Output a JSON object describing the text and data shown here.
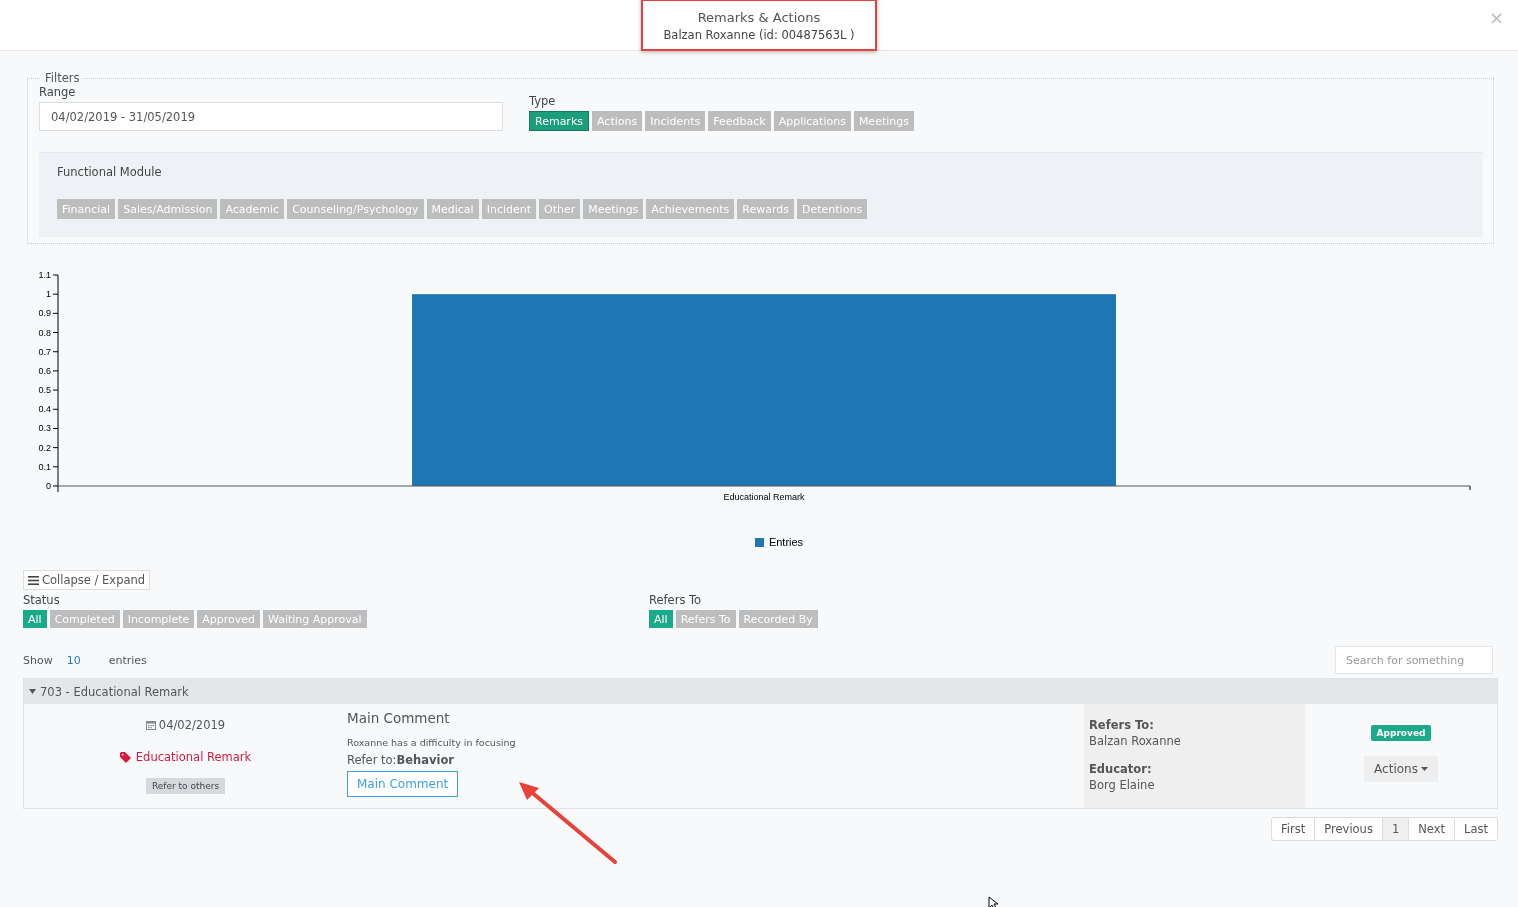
{
  "header": {
    "title": "Remarks & Actions",
    "subtitle": "Balzan Roxanne (id: 00487563L )",
    "close": "×"
  },
  "filters": {
    "legend": "Filters",
    "range_label": "Range",
    "range_value": "04/02/2019 - 31/05/2019",
    "type_label": "Type",
    "types": [
      {
        "label": "Remarks",
        "selected": true
      },
      {
        "label": "Actions",
        "selected": false
      },
      {
        "label": "Incidents",
        "selected": false
      },
      {
        "label": "Feedback",
        "selected": false
      },
      {
        "label": "Applications",
        "selected": false
      },
      {
        "label": "Meetings",
        "selected": false
      }
    ],
    "module_label": "Functional Module",
    "modules": [
      {
        "label": "Financial",
        "selected": false
      },
      {
        "label": "Sales/Admission",
        "selected": false
      },
      {
        "label": "Academic",
        "selected": false
      },
      {
        "label": "Counseling/Psychology",
        "selected": false
      },
      {
        "label": "Medical",
        "selected": false
      },
      {
        "label": "Incident",
        "selected": false
      },
      {
        "label": "Other",
        "selected": false
      },
      {
        "label": "Meetings",
        "selected": false
      },
      {
        "label": "Achievements",
        "selected": false
      },
      {
        "label": "Rewards",
        "selected": false
      },
      {
        "label": "Detentions",
        "selected": false
      }
    ]
  },
  "chart_data": {
    "type": "bar",
    "categories": [
      "Educational Remark"
    ],
    "series": [
      {
        "name": "Entries",
        "color": "#1f77b4",
        "values": [
          1
        ]
      }
    ],
    "ylim": [
      0,
      1.1
    ],
    "yticks": [
      0,
      0.1,
      0.2,
      0.3,
      0.4,
      0.5,
      0.6,
      0.7,
      0.8,
      0.9,
      1,
      1.1
    ]
  },
  "collapse_label": "Collapse / Expand",
  "status_label": "Status",
  "statuses": [
    {
      "label": "All",
      "selected": true
    },
    {
      "label": "Completed",
      "selected": false
    },
    {
      "label": "Incomplete",
      "selected": false
    },
    {
      "label": "Approved",
      "selected": false
    },
    {
      "label": "Waiting Approval",
      "selected": false
    }
  ],
  "refers_label": "Refers To",
  "refers": [
    {
      "label": "All",
      "selected": true
    },
    {
      "label": "Refers To",
      "selected": false
    },
    {
      "label": "Recorded By",
      "selected": false
    }
  ],
  "show_label": "Show",
  "show_value": "10",
  "entries_label": "entries",
  "search": {
    "placeholder": "Search for something"
  },
  "group": {
    "title": "703 - Educational Remark",
    "expanded": true
  },
  "entry": {
    "date": "04/02/2019",
    "tag": "Educational Remark",
    "refer_button": "Refer to others",
    "comment_title": "Main Comment",
    "comment_text": "Roxanne has a difficulty in focusing",
    "refer_to_label": "Refer to:",
    "refer_to_value": "Behavior",
    "comment_button": "Main Comment",
    "refers_to_label": "Refers To:",
    "refers_to_value": "Balzan Roxanne",
    "educator_label": "Educator:",
    "educator_value": "Borg Elaine",
    "status_badge": "Approved",
    "actions_button": "Actions"
  },
  "pagination": [
    {
      "label": "First",
      "selected": false
    },
    {
      "label": "Previous",
      "selected": false
    },
    {
      "label": "1",
      "selected": true
    },
    {
      "label": "Next",
      "selected": false
    },
    {
      "label": "Last",
      "selected": false
    }
  ]
}
